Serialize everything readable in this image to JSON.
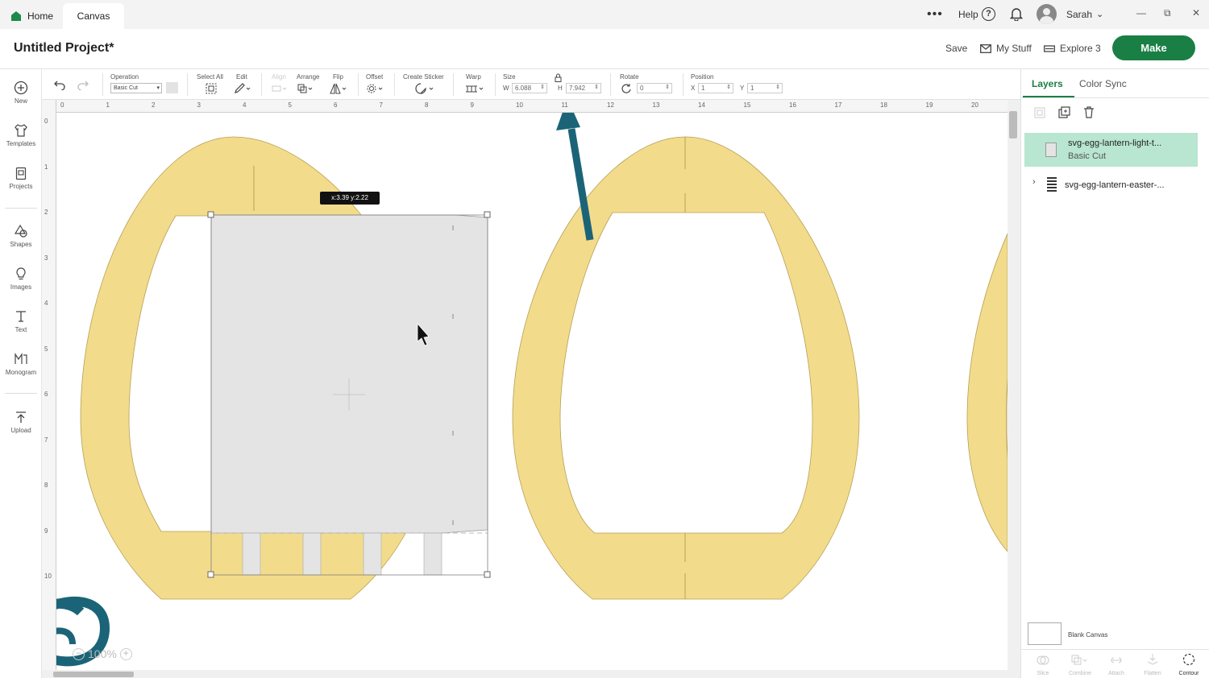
{
  "tabs": {
    "home": "Home",
    "canvas": "Canvas"
  },
  "topbar": {
    "more": "•••",
    "help": "Help",
    "help_icon": "?",
    "user": "Sarah"
  },
  "window": {
    "minimize": "—",
    "restore": "⧉",
    "close": "✕"
  },
  "project": {
    "title": "Untitled Project*",
    "save": "Save",
    "my_stuff": "My Stuff",
    "explore": "Explore 3",
    "make": "Make"
  },
  "leftbar": [
    {
      "label": "New",
      "icon": "plus-circle-icon"
    },
    {
      "label": "Templates",
      "icon": "shirt-icon"
    },
    {
      "label": "Projects",
      "icon": "clipboard-icon"
    },
    {
      "label": "Shapes",
      "icon": "shapes-icon"
    },
    {
      "label": "Images",
      "icon": "bulb-icon"
    },
    {
      "label": "Text",
      "icon": "text-icon"
    },
    {
      "label": "Monogram",
      "icon": "monogram-icon"
    },
    {
      "label": "Upload",
      "icon": "upload-icon"
    }
  ],
  "toolbar": {
    "operation_label": "Operation",
    "operation_value": "Basic Cut",
    "select_all": "Select All",
    "edit": "Edit",
    "align": "Align",
    "arrange": "Arrange",
    "flip": "Flip",
    "offset": "Offset",
    "create_sticker": "Create Sticker",
    "warp": "Warp",
    "size_label": "Size",
    "w_label": "W",
    "w_value": "6.088",
    "h_label": "H",
    "h_value": "7.942",
    "rotate_label": "Rotate",
    "rotate_value": "0",
    "position_label": "Position",
    "x_label": "X",
    "x_value": "1",
    "y_label": "Y",
    "y_value": "1"
  },
  "rulers": {
    "top": [
      "0",
      "1",
      "2",
      "3",
      "4",
      "5",
      "6",
      "7",
      "8",
      "9",
      "10",
      "11",
      "12",
      "13",
      "14",
      "15",
      "16",
      "17",
      "18",
      "19",
      "20"
    ],
    "left": [
      "0",
      "1",
      "2",
      "3",
      "4",
      "5",
      "6",
      "7",
      "8",
      "9",
      "10"
    ]
  },
  "canvas": {
    "tooltip": "x:3.39 y:2.22",
    "zoom": "100%",
    "zoom_minus": "−",
    "zoom_plus": "+"
  },
  "panel": {
    "tab_layers": "Layers",
    "tab_color_sync": "Color Sync",
    "layer1_title": "svg-egg-lantern-light-t...",
    "layer1_sub": "Basic Cut",
    "layer2_title": "svg-egg-lantern-easter-...",
    "blank_canvas": "Blank Canvas",
    "tools": [
      "Slice",
      "Combine",
      "Attach",
      "Flatten",
      "Contour"
    ]
  },
  "colors": {
    "accent": "#1a7f45",
    "egg_fill": "#f2dc8c",
    "arrow": "#1b6478",
    "selected_layer": "#b8e6d0"
  }
}
